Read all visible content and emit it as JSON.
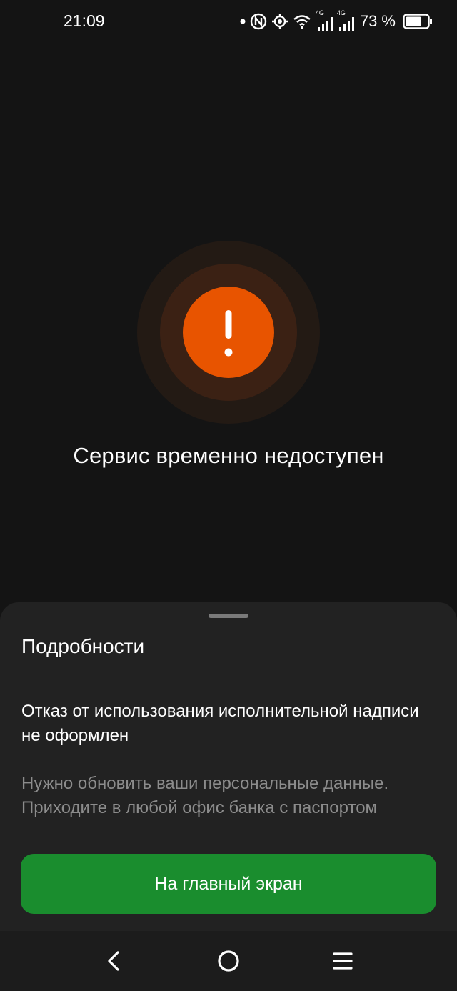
{
  "status_bar": {
    "time": "21:09",
    "network_type_1": "4G",
    "network_type_2": "4G",
    "battery_text": "73 %",
    "battery_level": 0.73,
    "icons": [
      "dot-icon",
      "nfc-icon",
      "location-icon",
      "wifi-icon",
      "signal-icon",
      "signal-icon",
      "battery-icon"
    ]
  },
  "alert": {
    "icon": "exclamation-icon",
    "accent_color": "#e85400",
    "title": "Сервис временно недоступен"
  },
  "sheet": {
    "title": "Подробности",
    "heading": "Отказ от использования исполнительной надписи не оформлен",
    "description": "Нужно обновить ваши персональные данные. Приходите в любой офис банка с паспортом",
    "button_label": "На главный экран",
    "button_color": "#1a8d2e"
  },
  "nav_bar": {
    "icons": [
      "back-icon",
      "home-icon",
      "menu-icon"
    ]
  }
}
